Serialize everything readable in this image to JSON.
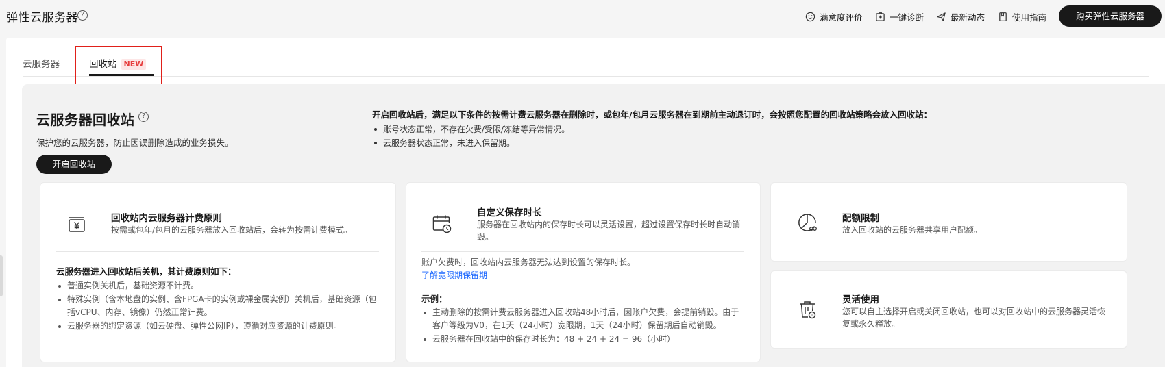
{
  "header": {
    "title": "弹性云服务器",
    "help_glyph": "?",
    "links": [
      {
        "label": "满意度评价",
        "icon": "smile-icon"
      },
      {
        "label": "一键诊断",
        "icon": "diagnose-icon"
      },
      {
        "label": "最新动态",
        "icon": "send-icon"
      },
      {
        "label": "使用指南",
        "icon": "book-icon"
      }
    ],
    "buy_label": "购买弹性云服务器"
  },
  "tabs": [
    {
      "label": "云服务器",
      "active": false
    },
    {
      "label": "回收站",
      "active": true,
      "badge": "NEW"
    }
  ],
  "recycle": {
    "title": "云服务器回收站",
    "help_glyph": "?",
    "description": "保护您的云服务器，防止因误删除造成的业务损失。",
    "enable_label": "开启回收站",
    "condition_title": "开启回收站后，满足以下条件的按需计费云服务器在删除时，或包年/包月云服务器在到期前主动退订时，会按照您配置的回收站策略会放入回收站：",
    "conditions": [
      "账号状态正常，不存在欠费/受限/冻结等异常情况。",
      "云服务器状态正常，未进入保留期。"
    ]
  },
  "cards": {
    "billing": {
      "title": "回收站内云服务器计费原则",
      "desc": "按需或包年/包月的云服务器放入回收站后，会转为按需计费模式。",
      "body_title": "云服务器进入回收站后关机，其计费原则如下：",
      "bullets": [
        "普通实例关机后，基础资源不计费。",
        "特殊实例（含本地盘的实例、含FPGA卡的实例或裸金属实例）关机后，基础资源（包括vCPU、内存、镜像）仍然正常计费。",
        "云服务器的绑定资源（如云硬盘、弹性公网IP），遵循对应资源的计费原则。"
      ],
      "icon": "billing-yen-icon"
    },
    "retention": {
      "title": "自定义保存时长",
      "desc": "服务器在回收站内的保存时长可以灵活设置，超过设置保存时长时自动销毁。",
      "note": "账户欠费时，回收站内云服务器无法达到设置的保存时长。",
      "link": "了解宽限期保留期",
      "example_title": "示例：",
      "bullets": [
        "主动删除的按需计费云服务器进入回收站48小时后，因账户欠费，会提前销毁。由于客户等级为V0，在1天（24小时）宽限期，1天（24小时）保留期后自动销毁。",
        "云服务器在回收站中的保存时长为：48 + 24 + 24 = 96（小时）"
      ],
      "icon": "calendar-clock-icon"
    },
    "quota": {
      "title": "配额限制",
      "desc": "放入回收站的云服务器共享用户配额。",
      "icon": "pie-chart-icon"
    },
    "flexible": {
      "title": "灵活使用",
      "desc": "您可以自主选择开启或关闭回收站，也可以对回收站中的云服务器灵活恢复或永久释放。",
      "icon": "recycle-bin-icon"
    }
  }
}
